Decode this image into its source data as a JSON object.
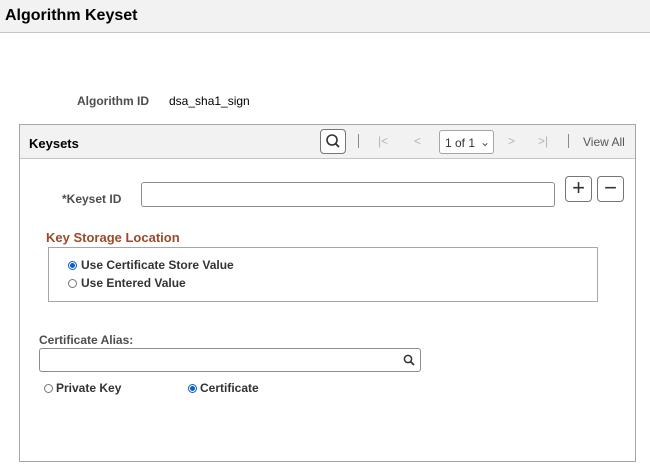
{
  "page": {
    "title": "Algorithm Keyset"
  },
  "algorithm": {
    "label": "Algorithm ID",
    "value": "dsa_sha1_sign"
  },
  "keysets": {
    "title": "Keysets",
    "nav": {
      "first": "|<",
      "prev": "<",
      "next": ">",
      "last": ">|",
      "sep": "|"
    },
    "pager": {
      "value": "1 of 1",
      "chevron": "⌄"
    },
    "view_all": "View All",
    "keyset_id": {
      "label": "*Keyset ID",
      "value": ""
    },
    "add_symbol": "+",
    "remove_symbol": "−",
    "storage": {
      "title": "Key Storage Location",
      "options": [
        {
          "label": "Use Certificate Store Value",
          "selected": true
        },
        {
          "label": "Use Entered Value",
          "selected": false
        }
      ]
    },
    "certificate_alias": {
      "label": "Certificate Alias:",
      "value": ""
    },
    "key_type": {
      "options": [
        {
          "label": "Private Key",
          "selected": false
        },
        {
          "label": "Certificate",
          "selected": true
        }
      ]
    }
  },
  "colors": {
    "accent": "#0a5fc5",
    "group_title": "#9c4a2b",
    "header_bg": "#f2f2f2"
  }
}
